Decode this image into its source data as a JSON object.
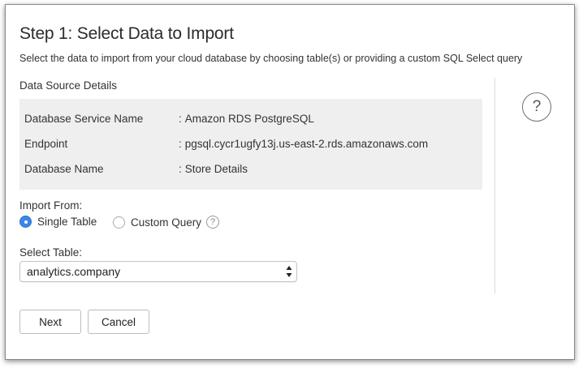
{
  "dialog": {
    "title": "Step 1: Select Data to Import",
    "subtitle": "Select the data to import from your cloud database by choosing table(s) or providing a custom SQL Select query"
  },
  "data_source": {
    "section_label": "Data Source Details",
    "rows": [
      {
        "key": "Database Service Name",
        "value": "Amazon RDS PostgreSQL"
      },
      {
        "key": "Endpoint",
        "value": "pgsql.cycr1ugfy13j.us-east-2.rds.amazonaws.com"
      },
      {
        "key": "Database Name",
        "value": "Store Details"
      }
    ],
    "colon": ":"
  },
  "help": {
    "glyph": "?"
  },
  "import_from": {
    "label": "Import From:",
    "options": [
      {
        "label": "Single Table",
        "selected": true
      },
      {
        "label": "Custom Query",
        "selected": false
      }
    ],
    "help_glyph": "?"
  },
  "select_table": {
    "label": "Select Table:",
    "value": "analytics.company"
  },
  "buttons": {
    "next": "Next",
    "cancel": "Cancel"
  },
  "colors": {
    "radio_selected": "#3c86e8",
    "details_background": "#efefef"
  }
}
